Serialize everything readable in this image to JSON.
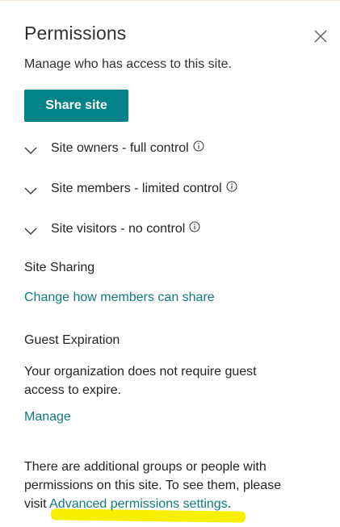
{
  "panel": {
    "title": "Permissions",
    "subtitle": "Manage who has access to this site.",
    "close_icon": "close-icon"
  },
  "share_button": {
    "label": "Share site"
  },
  "permission_groups": [
    {
      "label": "Site owners - full control",
      "icon": "chevron-down-icon",
      "info_icon": "info-icon"
    },
    {
      "label": "Site members - limited control",
      "icon": "chevron-down-icon",
      "info_icon": "info-icon"
    },
    {
      "label": "Site visitors - no control",
      "icon": "chevron-down-icon",
      "info_icon": "info-icon"
    }
  ],
  "site_sharing": {
    "heading": "Site Sharing",
    "link": "Change how members can share"
  },
  "guest_expiration": {
    "heading": "Guest Expiration",
    "text": "Your organization does not require guest access to expire.",
    "link": "Manage"
  },
  "additional_info": {
    "text_before": "There are additional groups or people with permissions on this site. To see them, please visit ",
    "link": "Advanced permissions settings",
    "text_after": "."
  },
  "colors": {
    "accent": "#038387",
    "link": "#0f7b83",
    "highlight": "#f7ef00"
  }
}
